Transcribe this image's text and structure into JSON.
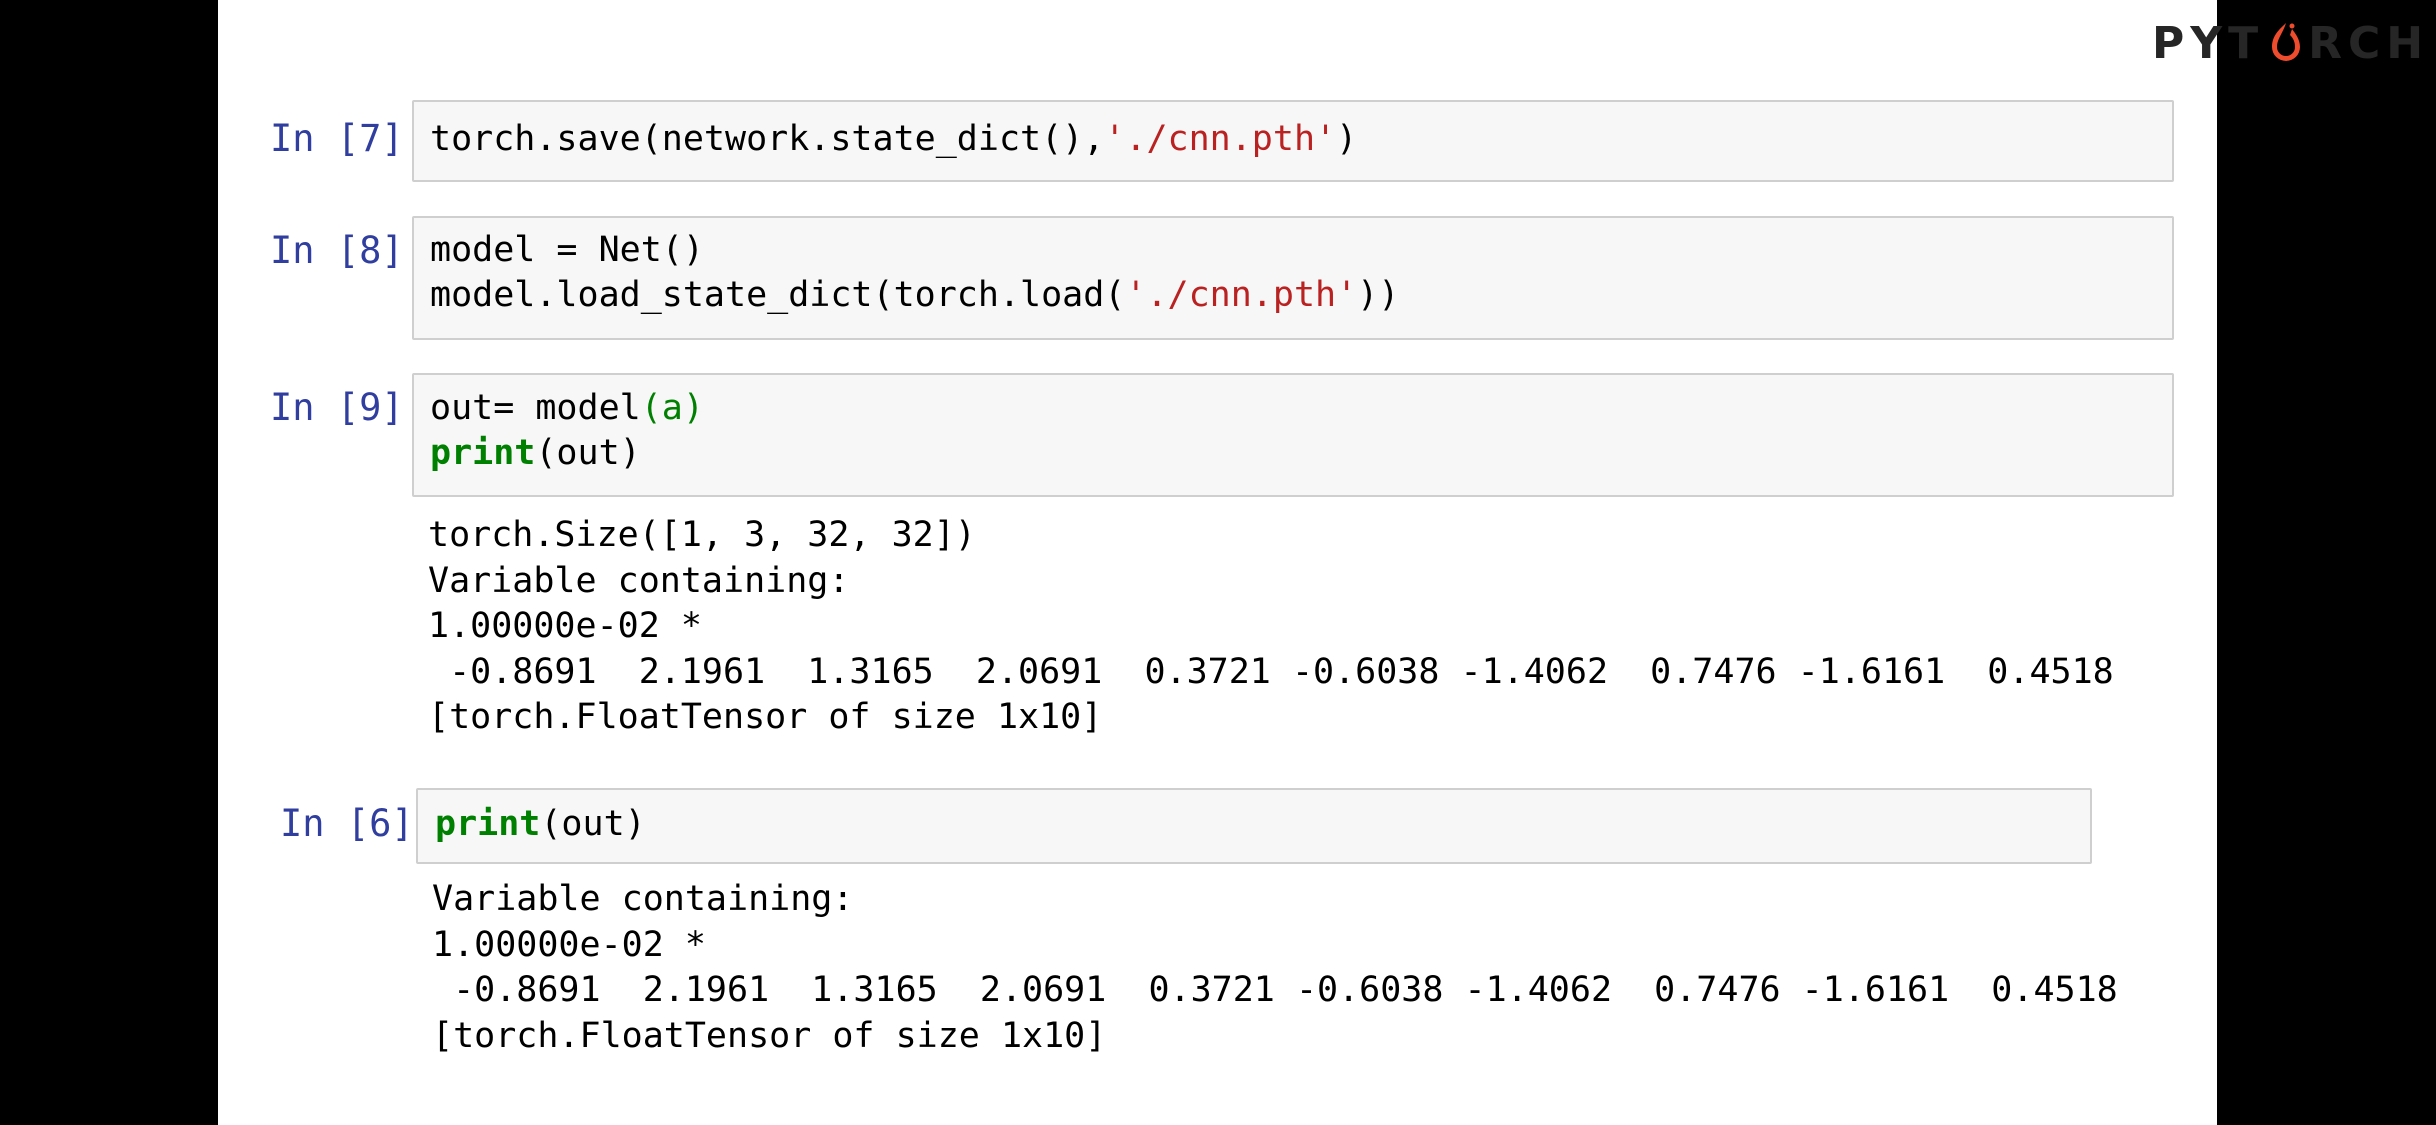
{
  "logo": {
    "text_before": "PYT",
    "text_after": "RCH",
    "flame_color": "#EE4C2C"
  },
  "cells": [
    {
      "prompt": "In [7]:",
      "code": [
        {
          "a": "torch.save(network.state_dict(),",
          "s": "'./cnn.pth'",
          "b": ")"
        }
      ]
    },
    {
      "prompt": "In [8]:",
      "code": [
        {
          "a": "model = Net()"
        },
        {
          "a": "model.load_state_dict(torch.load(",
          "s": "'./cnn.pth'",
          "b": "))"
        }
      ]
    },
    {
      "prompt": "In [9]:",
      "code": [
        {
          "a": "out= model",
          "g": "(a)"
        },
        {
          "k": "print",
          "a": "(out)"
        }
      ],
      "output": [
        "torch.Size([1, 3, 32, 32])",
        "Variable containing:",
        "1.00000e-02 *",
        " -0.8691  2.1961  1.3165  2.0691  0.3721 -0.6038 -1.4062  0.7476 -1.6161  0.4518",
        "[torch.FloatTensor of size 1x10]"
      ]
    },
    {
      "prompt": "In [6]:",
      "code": [
        {
          "k": "print",
          "a": "(out)"
        }
      ],
      "output": [
        "Variable containing:",
        "1.00000e-02 *",
        " -0.8691  2.1961  1.3165  2.0691  0.3721 -0.6038 -1.4062  0.7476 -1.6161  0.4518",
        "[torch.FloatTensor of size 1x10]"
      ]
    }
  ]
}
